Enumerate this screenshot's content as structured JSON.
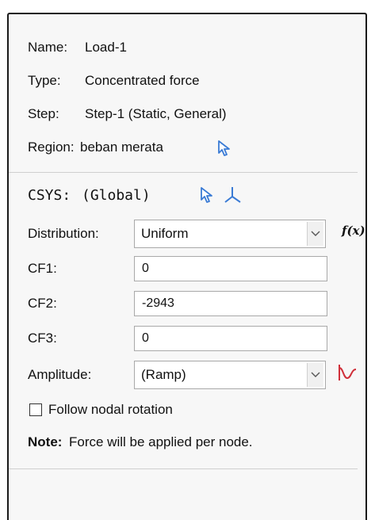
{
  "properties": {
    "name_label": "Name:",
    "name_value": "Load-1",
    "type_label": "Type:",
    "type_value": "Concentrated force",
    "step_label": "Step:",
    "step_value": "Step-1 (Static, General)",
    "region_label": "Region:",
    "region_value": "beban merata"
  },
  "csys": {
    "label": "CSYS:",
    "value": "(Global)"
  },
  "distribution": {
    "label": "Distribution:",
    "selected": "Uniform",
    "fx_label": "f(x)"
  },
  "fields": {
    "cf1_label": "CF1:",
    "cf1_value": "0",
    "cf2_label": "CF2:",
    "cf2_value": "-2943",
    "cf3_label": "CF3:",
    "cf3_value": "0"
  },
  "amplitude": {
    "label": "Amplitude:",
    "selected": "(Ramp)"
  },
  "options": {
    "follow_nodal_rotation_label": "Follow nodal rotation",
    "follow_nodal_rotation_checked": false
  },
  "note": {
    "label": "Note:",
    "text": "Force will be applied per node."
  },
  "colors": {
    "select_arrow_blue": "#3a7bd5",
    "amplitude_icon_red": "#d0303a"
  },
  "icons": {
    "region_pick": "select-arrow-icon",
    "csys_pick": "select-arrow-icon",
    "csys_axis": "axis-triad-icon",
    "distribution_dropdown": "chevron-down-icon",
    "amplitude_dropdown": "chevron-down-icon",
    "amplitude_create": "amplitude-curve-icon"
  }
}
